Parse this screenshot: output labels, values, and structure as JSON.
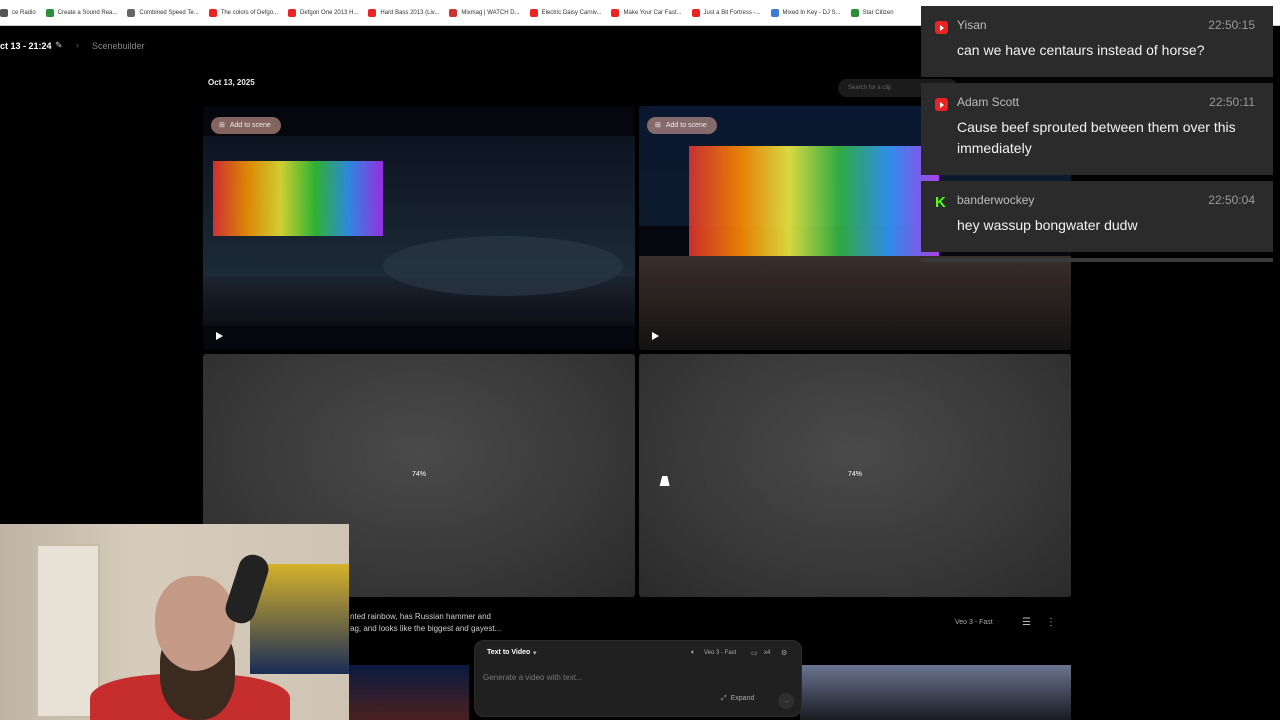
{
  "bookmarks": [
    {
      "label": "ce Radio",
      "color": "#555"
    },
    {
      "label": "Create a Sound Rea...",
      "color": "#2a8f3a"
    },
    {
      "label": "Combined Speed Te...",
      "color": "#666"
    },
    {
      "label": "The colors of Defgo...",
      "color": "#e22"
    },
    {
      "label": "Defgon One 2013 H...",
      "color": "#e22"
    },
    {
      "label": "Hard Bass 2013 (Liv...",
      "color": "#e22"
    },
    {
      "label": "Mixmag | WATCH D...",
      "color": "#c33"
    },
    {
      "label": "Electric Daisy Carniv...",
      "color": "#e22"
    },
    {
      "label": "Make Your Car Fast...",
      "color": "#e22"
    },
    {
      "label": "Just a Bit Fortress -...",
      "color": "#e22"
    },
    {
      "label": "Mixed In Key - DJ S...",
      "color": "#3a7bd5"
    },
    {
      "label": "Star Citizen",
      "color": "#2a8f3a"
    }
  ],
  "header": {
    "project_title": "ct 13 - 21:24",
    "breadcrumb": "Scenebuilder"
  },
  "date_label": "Oct 13, 2025",
  "search_placeholder": "Search for a clip",
  "tiles": {
    "add_to_scene": "Add to scene",
    "progress_1": "74%",
    "progress_2": "74%"
  },
  "description": {
    "line1": "nted rainbow, has Russian hammer and",
    "line2": "ag, and looks like the biggest and gayest..."
  },
  "model_label_right": "Veo 3 - Fast",
  "composer": {
    "mode": "Text to Video",
    "model": "Veo 3 - Fast",
    "count": "x4",
    "placeholder": "Generate a video with text...",
    "expand": "Expand"
  },
  "chat": [
    {
      "platform": "youtube",
      "author": "Yisan",
      "time": "22:50:15",
      "text": "can we have centaurs instead of horse?"
    },
    {
      "platform": "youtube",
      "author": "Adam Scott",
      "time": "22:50:11",
      "text": "Cause beef sprouted between them over this immediately"
    },
    {
      "platform": "kick",
      "author": "banderwockey",
      "time": "22:50:04",
      "text": "hey wassup bongwater dudw"
    }
  ]
}
